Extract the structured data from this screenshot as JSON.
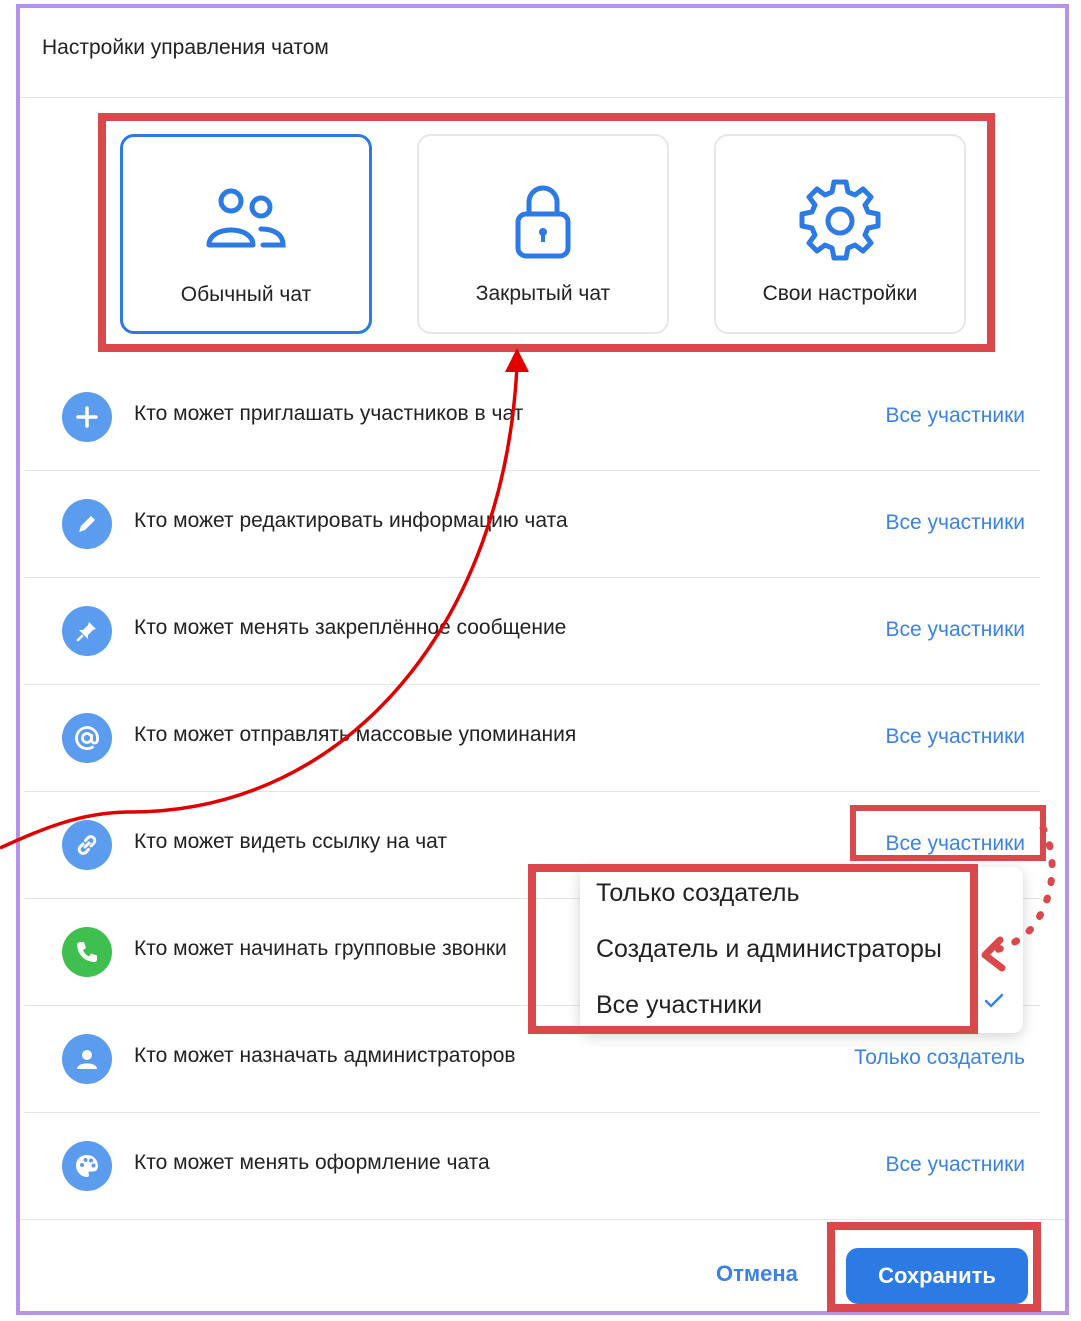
{
  "dialog": {
    "title": "Настройки управления чатом"
  },
  "presets": [
    {
      "label": "Обычный чат",
      "icon": "users-icon",
      "active": true
    },
    {
      "label": "Закрытый чат",
      "icon": "lock-icon",
      "active": false
    },
    {
      "label": "Свои настройки",
      "icon": "gear-icon",
      "active": false
    }
  ],
  "settings": [
    {
      "label": "Кто может приглашать участников в чат",
      "value": "Все участники",
      "icon": "plus-icon"
    },
    {
      "label": "Кто может редактировать информацию чата",
      "value": "Все участники",
      "icon": "pencil-icon"
    },
    {
      "label": "Кто может менять закреплённое сообщение",
      "value": "Все участники",
      "icon": "pin-icon"
    },
    {
      "label": "Кто может отправлять массовые упоминания",
      "value": "Все участники",
      "icon": "at-icon"
    },
    {
      "label": "Кто может видеть ссылку на чат",
      "value": "Все участники",
      "icon": "link-icon"
    },
    {
      "label": "Кто может начинать групповые звонки",
      "value": "",
      "icon": "phone-icon"
    },
    {
      "label": "Кто может назначать администраторов",
      "value": "Только создатель",
      "icon": "person-icon"
    },
    {
      "label": "Кто может менять оформление чата",
      "value": "Все участники",
      "icon": "palette-icon"
    }
  ],
  "dropdown": {
    "options": [
      "Только создатель",
      "Создатель и администраторы",
      "Все участники"
    ],
    "selected": "Все участники"
  },
  "footer": {
    "cancel_label": "Отмена",
    "save_label": "Сохранить"
  },
  "colors": {
    "accent": "#2c7be5",
    "link": "#3b82e6",
    "highlight": "#d9484a",
    "arrow": "#e00000",
    "frame": "#b592ec"
  }
}
